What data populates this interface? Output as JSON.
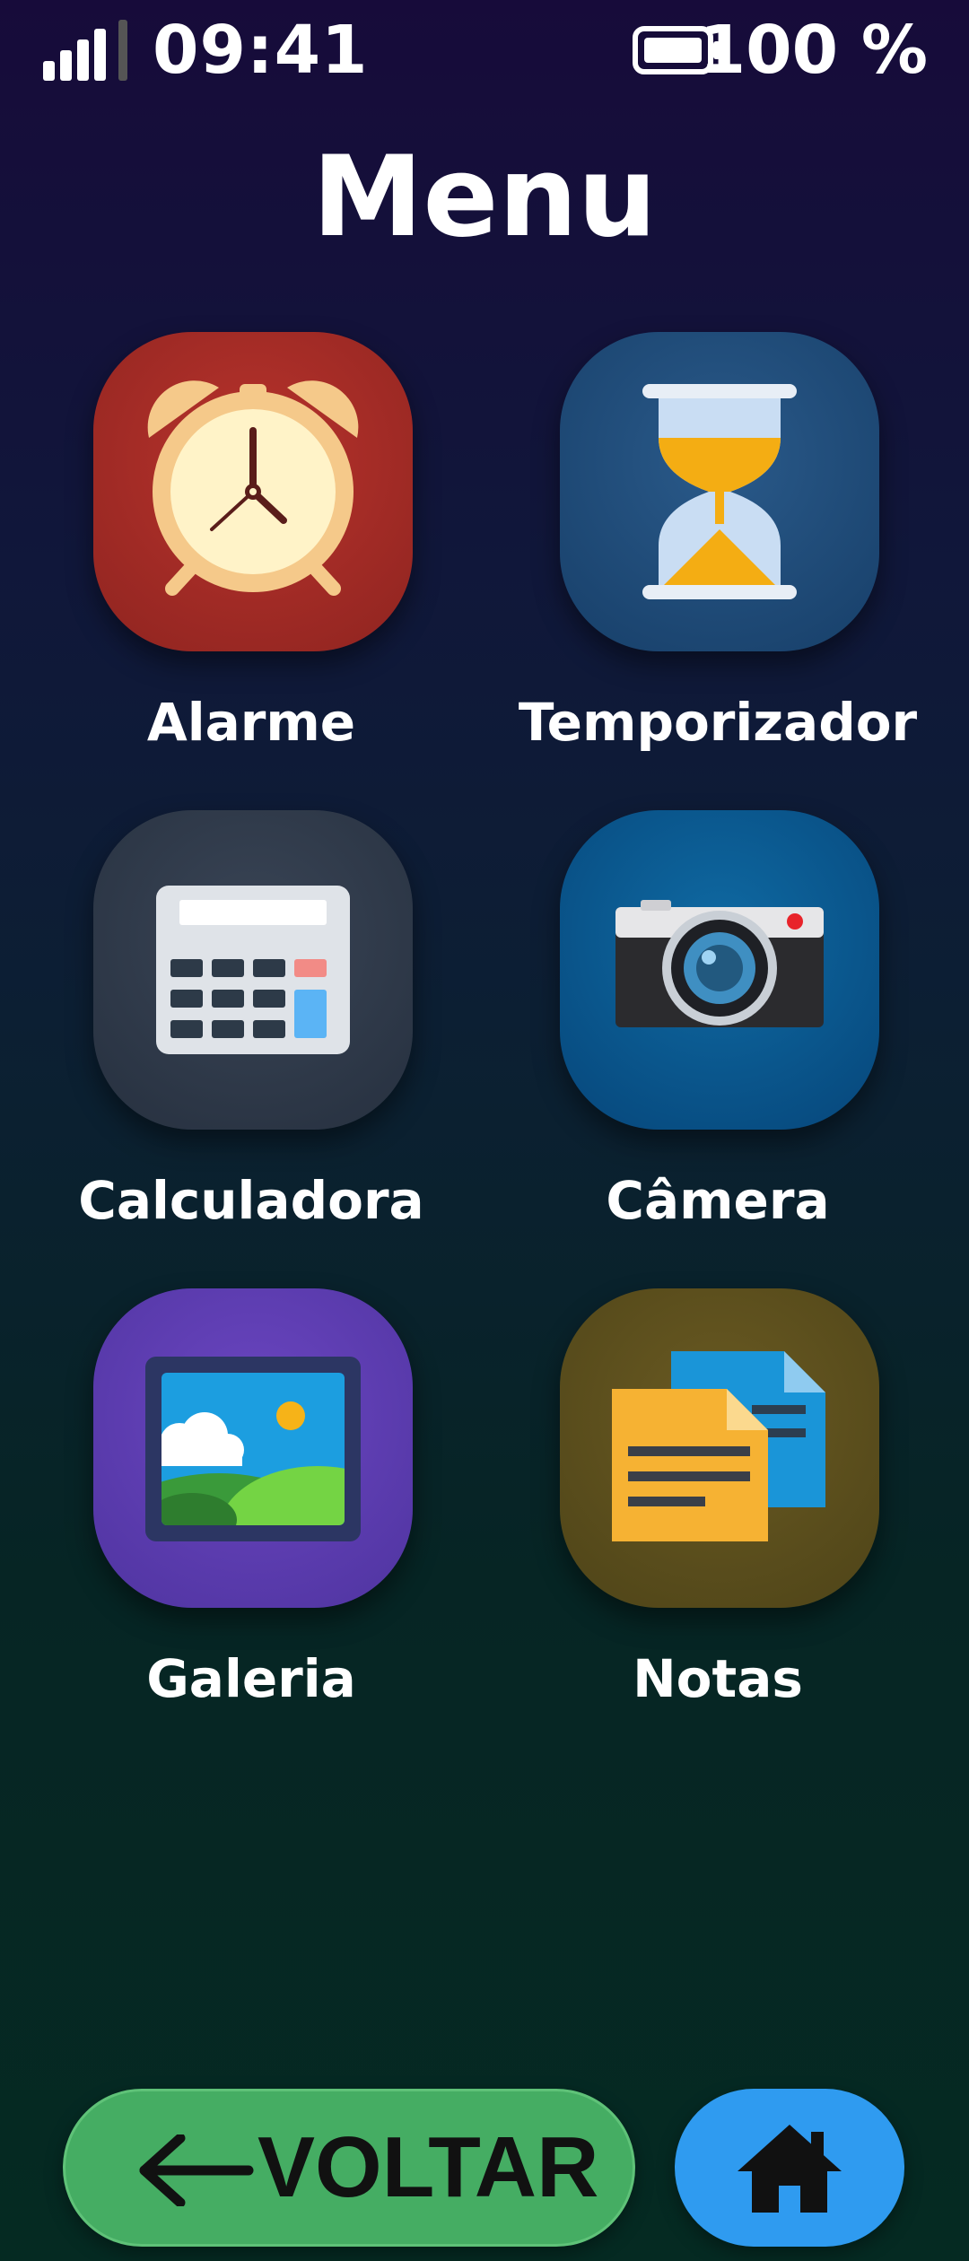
{
  "status_bar": {
    "time": "09:41",
    "battery": "100 %",
    "icons": [
      "signal-icon",
      "battery-icon"
    ]
  },
  "page_title": "Menu",
  "apps": [
    {
      "label": "Alarme",
      "icon": "alarm-clock-icon",
      "color": "#9f2a25"
    },
    {
      "label": "Temporizador",
      "icon": "hourglass-icon",
      "color": "#1f4c7a"
    },
    {
      "label": "Calculadora",
      "icon": "calculator-icon",
      "color": "#2f3a4a"
    },
    {
      "label": "Câmera",
      "icon": "camera-icon",
      "color": "#0a5890"
    },
    {
      "label": "Galeria",
      "icon": "gallery-icon",
      "color": "#5d3db1"
    },
    {
      "label": "Notas",
      "icon": "notes-icon",
      "color": "#5c4f1d"
    }
  ],
  "bottom_bar": {
    "back_label": "VOLTAR",
    "back_icon": "arrow-left-icon",
    "home_icon": "home-icon",
    "back_color": "#45ad63",
    "home_color": "#2f9bf0"
  }
}
